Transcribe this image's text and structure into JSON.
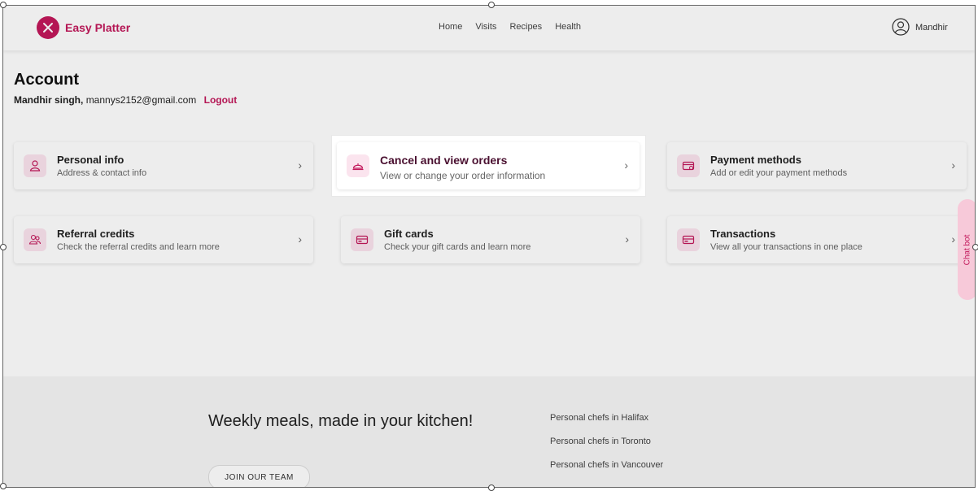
{
  "header": {
    "brand": "Easy Platter",
    "nav": [
      "Home",
      "Visits",
      "Recipes",
      "Health"
    ],
    "user_name": "Mandhir"
  },
  "account": {
    "title": "Account",
    "name": "Mandhir singh,",
    "email": "mannys2152@gmail.com",
    "logout": "Logout"
  },
  "cards": [
    {
      "title": "Personal info",
      "subtitle": "Address & contact info",
      "icon": "person-icon"
    },
    {
      "title": "Cancel and view orders",
      "subtitle": "View or change your order information",
      "icon": "cloche-icon"
    },
    {
      "title": "Payment methods",
      "subtitle": "Add or edit your payment methods",
      "icon": "card-icon"
    },
    {
      "title": "Referral credits",
      "subtitle": "Check the referral credits and learn more",
      "icon": "people-icon"
    },
    {
      "title": "Gift cards",
      "subtitle": "Check your gift cards and learn more",
      "icon": "giftcard-icon"
    },
    {
      "title": "Transactions",
      "subtitle": "View all your transactions in one place",
      "icon": "card-icon"
    }
  ],
  "chatbot": "Chat bot",
  "footer": {
    "tagline": "Weekly meals, made in your kitchen!",
    "join": "JOIN OUR TEAM",
    "links": [
      "Personal chefs in Halifax",
      "Personal chefs in Toronto",
      "Personal chefs in Vancouver"
    ]
  },
  "colors": {
    "accent": "#c2185b",
    "icon_bg": "#fbe4ee"
  }
}
